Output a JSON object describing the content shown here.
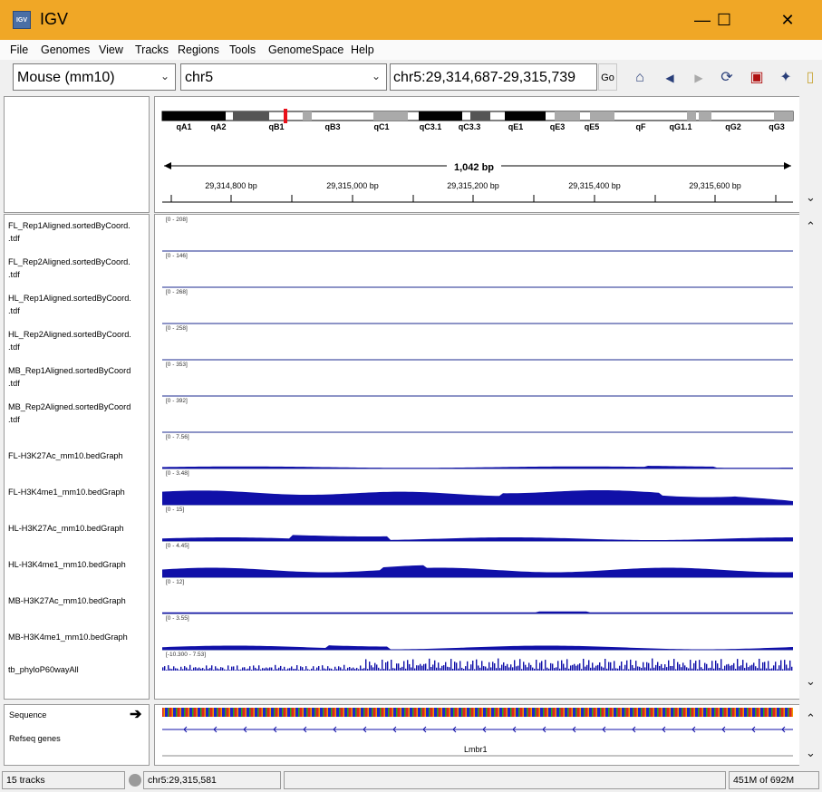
{
  "window": {
    "title": "IGV",
    "icon_text": "IGV",
    "minimize": "—",
    "maximize": "☐",
    "close": "✕"
  },
  "menu": [
    "File",
    "Genomes",
    "View",
    "Tracks",
    "Regions",
    "Tools",
    "GenomeSpace",
    "Help"
  ],
  "toolbar": {
    "genome": "Mouse (mm10)",
    "chromosome": "chr5",
    "locus": "chr5:29,314,687-29,315,739",
    "go_label": "Go"
  },
  "ideogram": {
    "bands": [
      "qA1",
      "qA2",
      "qB1",
      "qB3",
      "qC1",
      "qC3.1",
      "qC3.3",
      "qE1",
      "qE3",
      "qE5",
      "qF",
      "qG1.1",
      "qG2",
      "qG3"
    ]
  },
  "ruler": {
    "span_label": "1,042 bp",
    "ticks": [
      "29,314,800 bp",
      "29,315,000 bp",
      "29,315,200 bp",
      "29,315,400 bp",
      "29,315,600 bp"
    ]
  },
  "tracks": [
    {
      "name1": "FL_Rep1Aligned.sortedByCoord.",
      "name2": ".tdf",
      "range": "[0 - 208]"
    },
    {
      "name1": "FL_Rep2Aligned.sortedByCoord.",
      "name2": ".tdf",
      "range": "[0 - 146]"
    },
    {
      "name1": "HL_Rep1Aligned.sortedByCoord.",
      "name2": ".tdf",
      "range": "[0 - 268]"
    },
    {
      "name1": "HL_Rep2Aligned.sortedByCoord.",
      "name2": ".tdf",
      "range": "[0 - 258]"
    },
    {
      "name1": "MB_Rep1Aligned.sortedByCoord",
      "name2": ".tdf",
      "range": "[0 - 353]"
    },
    {
      "name1": "MB_Rep2Aligned.sortedByCoord",
      "name2": ".tdf",
      "range": "[0 - 392]"
    },
    {
      "name1": "FL-H3K27Ac_mm10.bedGraph",
      "name2": "",
      "range": "[0 - 7.56]"
    },
    {
      "name1": "FL-H3K4me1_mm10.bedGraph",
      "name2": "",
      "range": "[0 - 3.48]"
    },
    {
      "name1": "HL-H3K27Ac_mm10.bedGraph",
      "name2": "",
      "range": "[0 - 15]"
    },
    {
      "name1": "HL-H3K4me1_mm10.bedGraph",
      "name2": "",
      "range": "[0 - 4.45]"
    },
    {
      "name1": "MB-H3K27Ac_mm10.bedGraph",
      "name2": "",
      "range": "[0 - 12]"
    },
    {
      "name1": "MB-H3K4me1_mm10.bedGraph",
      "name2": "",
      "range": "[0 - 3.55]"
    },
    {
      "name1": "tb_phyloP60wayAll",
      "name2": "",
      "range": "[-10.300 - 7.53]"
    }
  ],
  "feature_tracks": {
    "sequence": "Sequence",
    "refseq": "Refseq genes",
    "gene_name": "Lmbr1"
  },
  "status": {
    "tracks": "15 tracks",
    "position": "chr5:29,315,581",
    "memory": "451M of 692M"
  },
  "colors": {
    "titlebar": "#f0a726",
    "track_fill": "#1010a8",
    "centromere": "#e8101a"
  }
}
